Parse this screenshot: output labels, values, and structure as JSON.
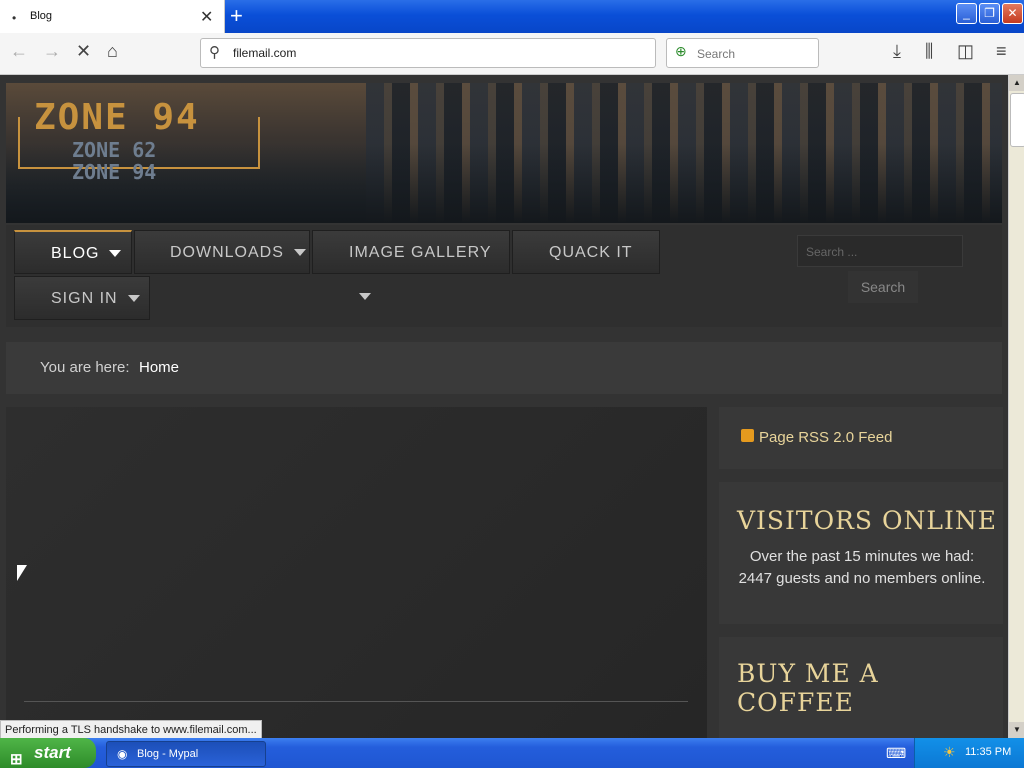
{
  "browser": {
    "tab_title": "Blog",
    "url": "filemail.com",
    "search_placeholder": "Search",
    "status": "Performing a TLS handshake to www.filemail.com..."
  },
  "site": {
    "logo_main": "ZONE 94",
    "logo_sub1": "ZONE 62",
    "logo_sub2": "ZONE 94",
    "menu": [
      {
        "label": "BLOG",
        "has_caret": true,
        "active": true
      },
      {
        "label": "DOWNLOADS",
        "has_caret": true
      },
      {
        "label": "IMAGE GALLERY",
        "has_caret": true
      },
      {
        "label": "QUACK IT",
        "has_caret": false
      },
      {
        "label": "SIGN IN",
        "has_caret": true
      }
    ],
    "search_placeholder": "Search ...",
    "search_button": "Search",
    "breadcrumb_label": "You are here:",
    "breadcrumb_current": "Home",
    "rss_link": "Page RSS 2.0 Feed",
    "visitors_title": "VISITORS ONLINE",
    "visitors_text": "Over the past 15 minutes we had: 2447 guests and no members online.",
    "coffee_title": "BUY ME A COFFEE"
  },
  "taskbar": {
    "start": "start",
    "task_label": "Blog - Mypal",
    "clock": "11:35 PM"
  },
  "colors": {
    "accent": "#c7923e",
    "sidebar_heading": "#e8d49a",
    "page_bg": "#333333"
  }
}
